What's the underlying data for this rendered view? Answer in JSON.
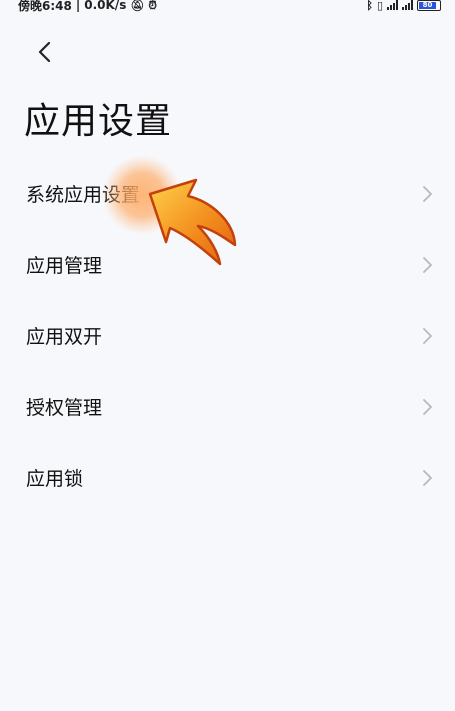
{
  "status_bar": {
    "time": "傍晚6:48",
    "net_speed": "0.0K/s",
    "battery_level": "80"
  },
  "header": {
    "back_icon": "chevron-left-icon",
    "title": "应用设置"
  },
  "menu": {
    "items": [
      {
        "label": "系统应用设置",
        "icon": "chevron-right-icon"
      },
      {
        "label": "应用管理",
        "icon": "chevron-right-icon"
      },
      {
        "label": "应用双开",
        "icon": "chevron-right-icon"
      },
      {
        "label": "授权管理",
        "icon": "chevron-right-icon"
      },
      {
        "label": "应用锁",
        "icon": "chevron-right-icon"
      }
    ]
  },
  "colors": {
    "background": "#f7f8fc",
    "pointer_orange": "#f07a1a",
    "chevron": "#b5b8c0"
  }
}
